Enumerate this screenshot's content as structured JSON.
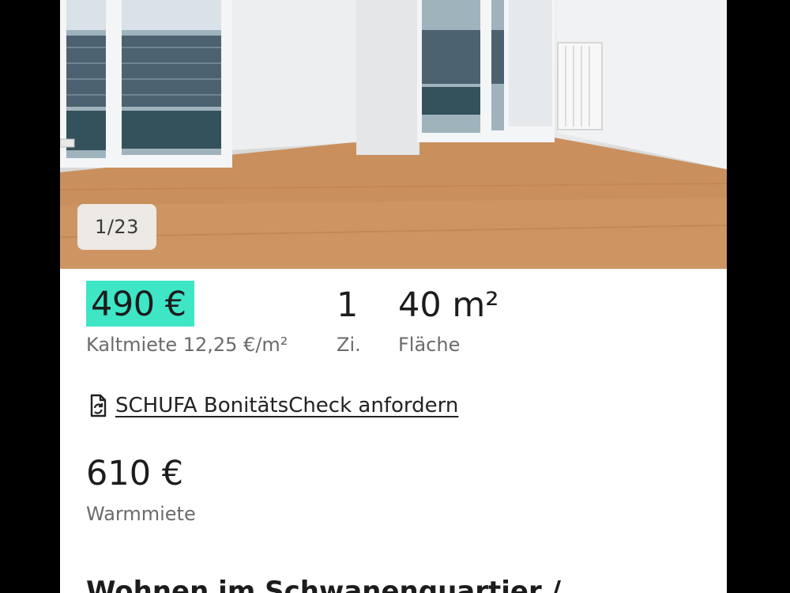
{
  "gallery": {
    "counter": "1/23"
  },
  "facts": {
    "cold_rent": "490 €",
    "cold_rent_label": "Kaltmiete 12,25 €/m²",
    "rooms": "1",
    "rooms_label": "Zi.",
    "area": "40 m²",
    "area_label": "Fläche"
  },
  "schufa": {
    "link_label": "SCHUFA BonitätsCheck anfordern",
    "icon": "document-refresh-icon"
  },
  "warm": {
    "value": "610 €",
    "label": "Warmmiete"
  },
  "listing": {
    "title": "Wohnen im Schwanenquartier /"
  },
  "colors": {
    "price_highlight": "#3ee6c6",
    "text_primary": "#1c1c1c",
    "text_secondary": "#6b6b6b"
  }
}
